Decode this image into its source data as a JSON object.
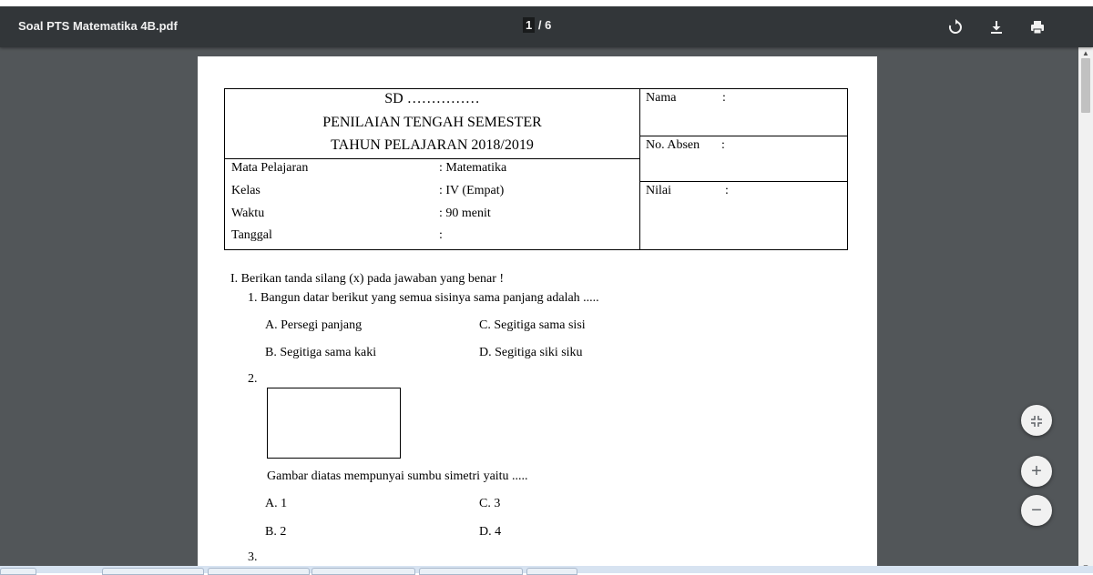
{
  "toolbar": {
    "title": "Soal PTS Matematika 4B.pdf",
    "current_page": "1",
    "page_sep": " / ",
    "total_pages": "6",
    "icons": [
      "rotate-icon",
      "download-icon",
      "print-icon"
    ]
  },
  "document": {
    "header": {
      "school": "SD ……………",
      "exam": "PENILAIAN TENGAH SEMESTER",
      "year": "TAHUN PELAJARAN 2018/2019",
      "rows": [
        {
          "label": "Mata Pelajaran",
          "value": ": Matematika"
        },
        {
          "label": "Kelas",
          "value": ": IV (Empat)"
        },
        {
          "label": "Waktu",
          "value": ": 90 menit"
        },
        {
          "label": "Tanggal",
          "value": ":"
        }
      ],
      "right": [
        {
          "label": "Nama",
          "colon": ":"
        },
        {
          "label": "No. Absen",
          "colon": ":"
        },
        {
          "label": "Nilai",
          "colon": ":"
        }
      ]
    },
    "section": "I.  Berikan tanda silang (x) pada jawaban yang benar !",
    "q1": {
      "text": "1.   Bangun datar berikut yang semua sisinya sama panjang adalah .....",
      "a": "A.  Persegi panjang",
      "b": "B.  Segitiga sama kaki",
      "c": "C.  Segitiga sama sisi",
      "d": "D.  Segitiga siki siku"
    },
    "q2": {
      "num": "2.",
      "text": "Gambar diatas mempunyai sumbu simetri yaitu .....",
      "a": "A.  1",
      "b": "B.  2",
      "c": "C.  3",
      "d": "D.  4"
    },
    "q3": {
      "num": "3."
    }
  },
  "controls": {
    "fit_icon": "fit-page-icon",
    "zoom_in": "+",
    "zoom_out": "−"
  }
}
